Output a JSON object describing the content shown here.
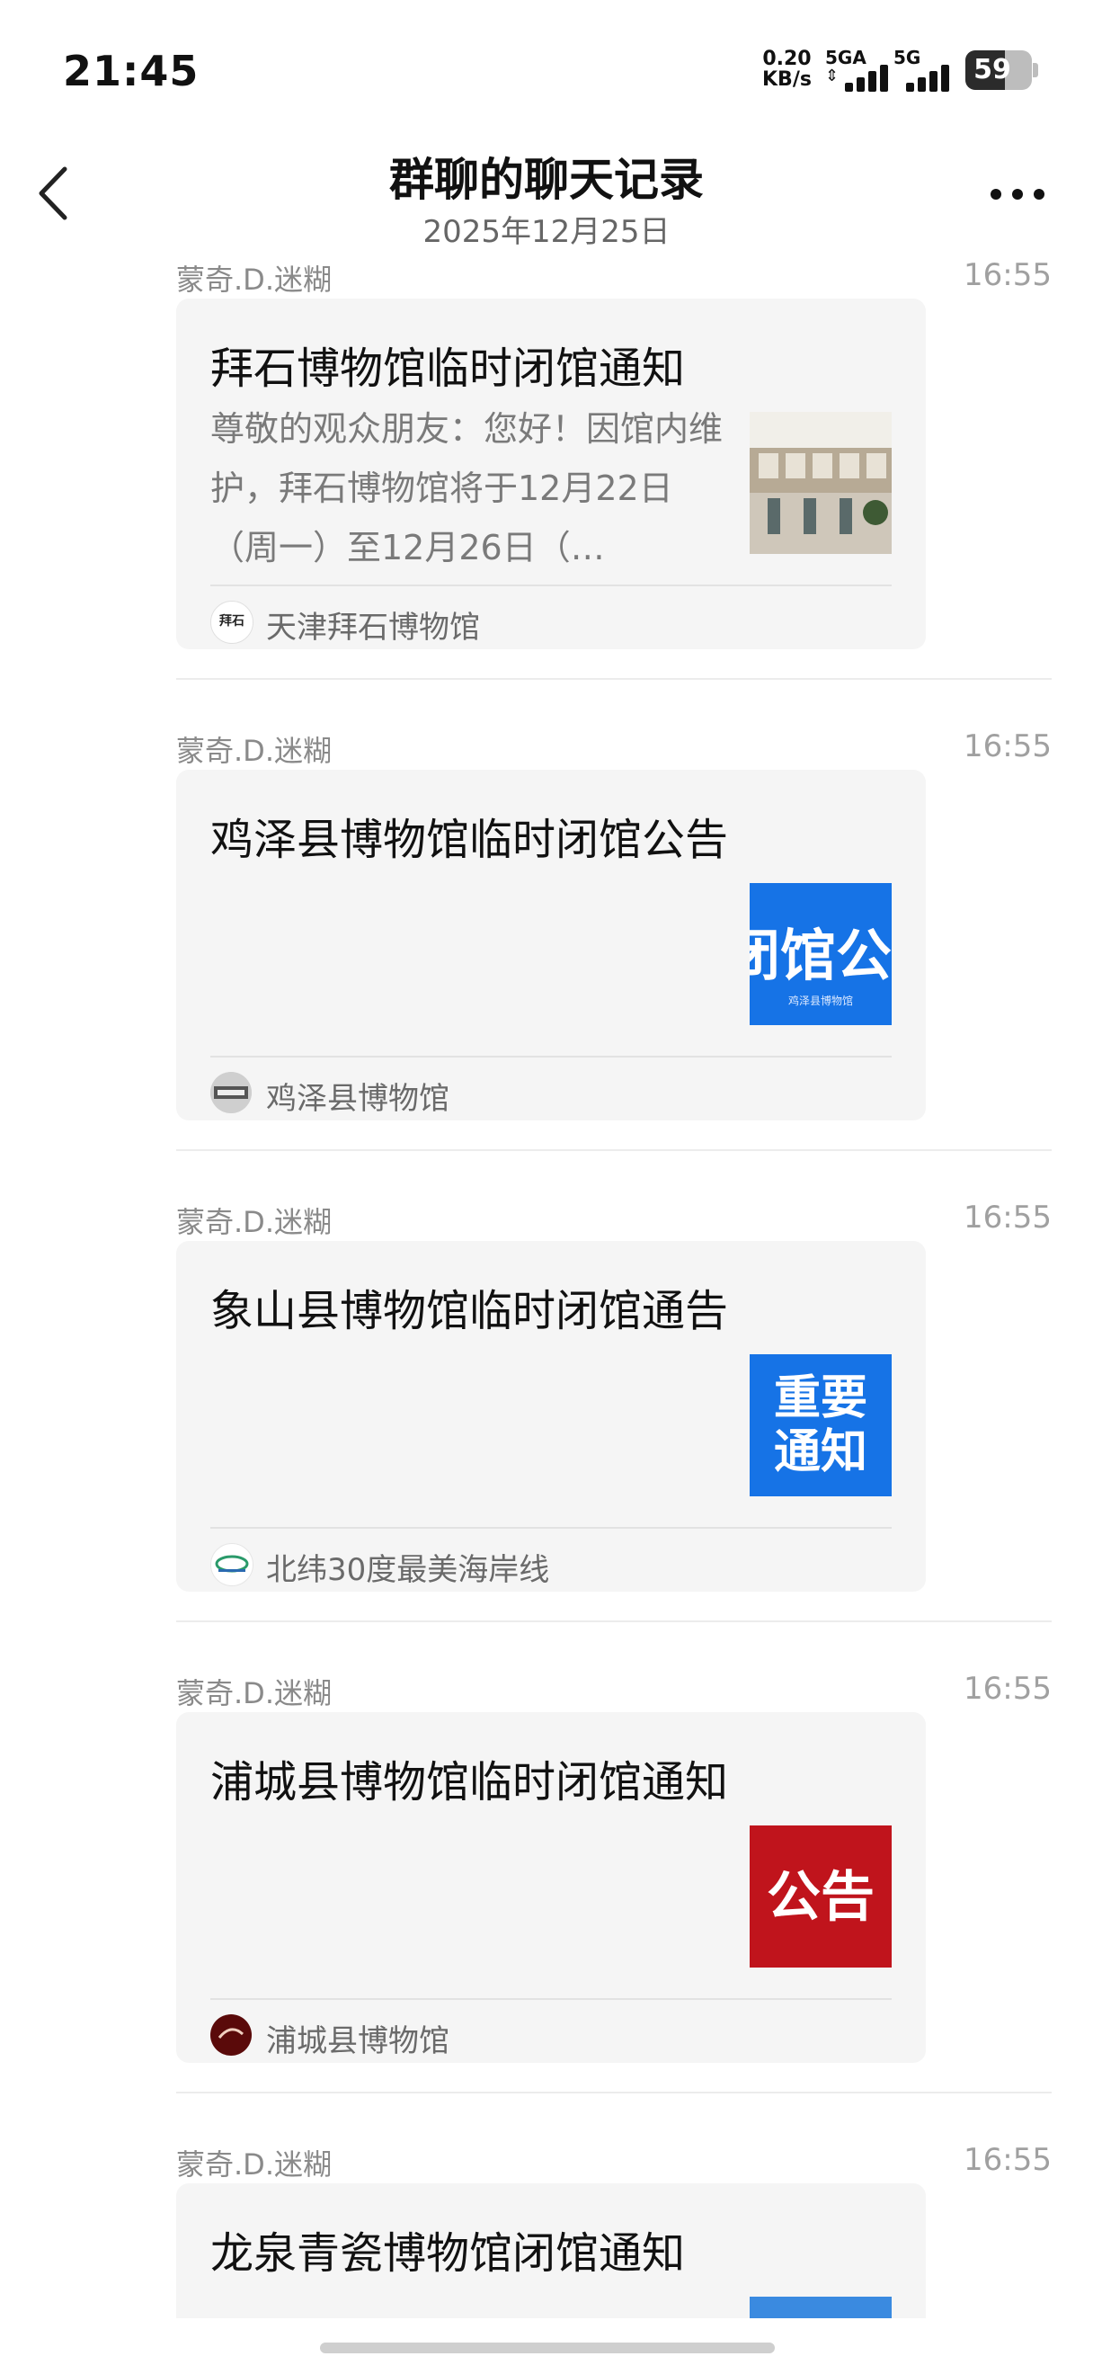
{
  "status_bar": {
    "time": "21:45",
    "net_speed_value": "0.20",
    "net_speed_unit": "KB/s",
    "sim1_label": "5GA",
    "sim2_label": "5G",
    "battery_level": "59",
    "battery_fraction": 0.59
  },
  "header": {
    "title": "群聊的聊天记录",
    "date": "2025年12月25日",
    "back_icon": "chevron-left-icon",
    "more_icon": "more-horizontal-icon"
  },
  "messages": [
    {
      "sender": "蒙奇.D.迷糊",
      "time": "16:55",
      "title": "拜石博物馆临时闭馆通知",
      "description": "尊敬的观众朋友：您好！因馆内维护，拜石博物馆将于12月22日（周一）至12月26日（…",
      "source": "天津拜石博物馆",
      "avatar_text": "拜石",
      "thumb_text": ""
    },
    {
      "sender": "蒙奇.D.迷糊",
      "time": "16:55",
      "title": "鸡泽县博物馆临时闭馆公告",
      "description": "",
      "source": "鸡泽县博物馆",
      "thumb_text": "闭馆公告",
      "thumb_sub": "鸡泽县博物馆"
    },
    {
      "sender": "蒙奇.D.迷糊",
      "time": "16:55",
      "title": "象山县博物馆临时闭馆通告",
      "description": "",
      "source": "北纬30度最美海岸线",
      "thumb_text_1": "重要",
      "thumb_text_2": "通知"
    },
    {
      "sender": "蒙奇.D.迷糊",
      "time": "16:55",
      "title": "浦城县博物馆临时闭馆通知",
      "description": "",
      "source": "浦城县博物馆",
      "thumb_text": "公告"
    },
    {
      "sender": "蒙奇.D.迷糊",
      "time": "16:55",
      "title": "龙泉青瓷博物馆闭馆通知"
    }
  ],
  "colors": {
    "card_bg": "#f5f5f5",
    "blue_thumb": "#1673e6",
    "red_thumb": "#c0141c"
  }
}
